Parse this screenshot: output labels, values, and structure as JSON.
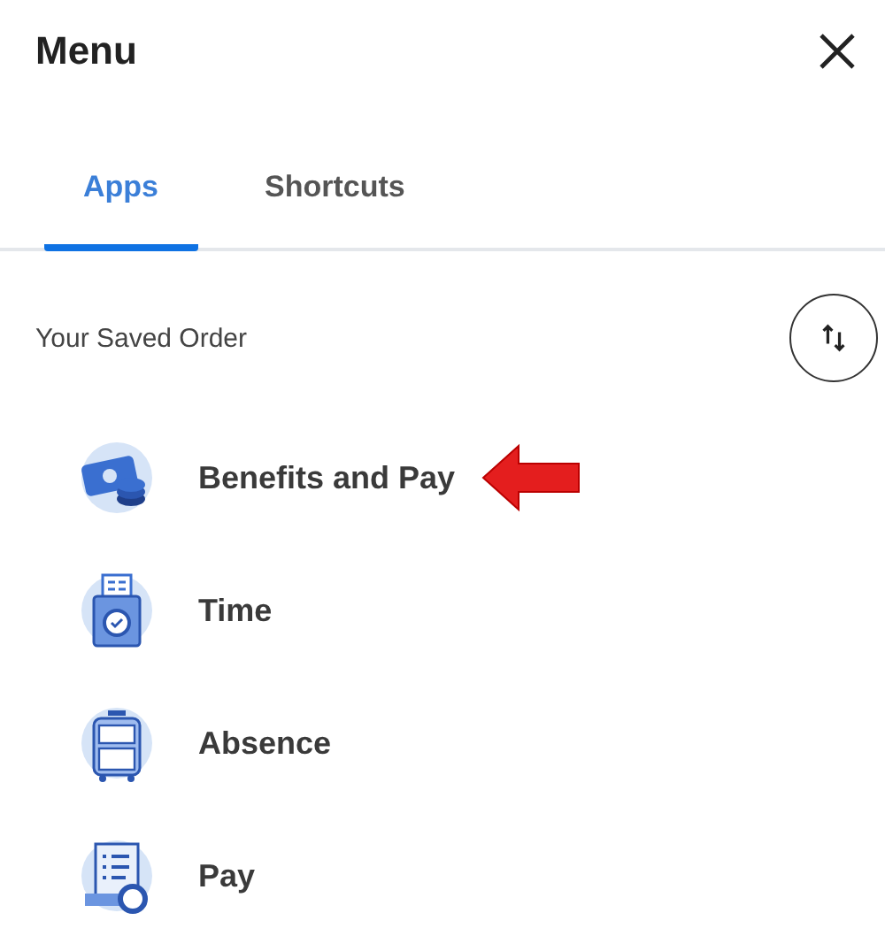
{
  "header": {
    "title": "Menu"
  },
  "tabs": [
    {
      "label": "Apps",
      "selected": true
    },
    {
      "label": "Shortcuts",
      "selected": false
    }
  ],
  "section": {
    "title": "Your Saved Order"
  },
  "apps": [
    {
      "label": "Benefits and Pay",
      "highlighted": true
    },
    {
      "label": "Time",
      "highlighted": false
    },
    {
      "label": "Absence",
      "highlighted": false
    },
    {
      "label": "Pay",
      "highlighted": false
    }
  ]
}
